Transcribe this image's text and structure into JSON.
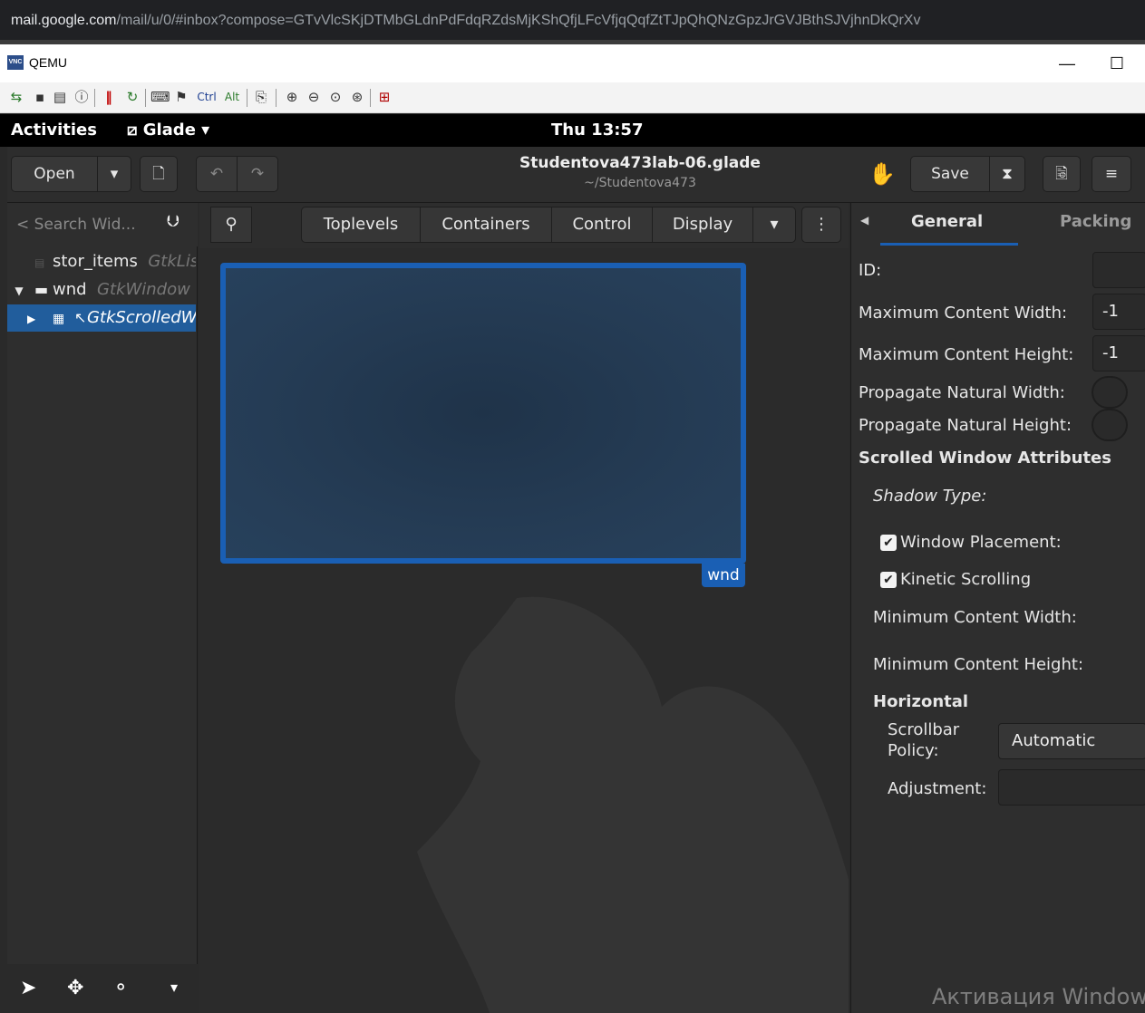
{
  "browser": {
    "url_host": "mail.google.com",
    "url_path": "/mail/u/0/#inbox?compose=GTvVlcSKjDTMbGLdnPdFdqRZdsMjKShQfjLFcVfjqQqfZtTJpQhQNzGpzJrGVJBthSJVjhnDkQrXv"
  },
  "qemu": {
    "title": "QEMU",
    "minimize": "—",
    "maximize": "☐",
    "toolbar_labels": {
      "ctrl": "Ctrl",
      "alt": "Alt"
    }
  },
  "gnome": {
    "activities": "Activities",
    "app_menu": "Glade ▾",
    "clock": "Thu 13:57"
  },
  "header": {
    "open_label": "Open",
    "title": "Studentova473lab-06.glade",
    "subtitle": "~/Studentova473",
    "save_label": "Save"
  },
  "left": {
    "search_placeholder": "< Search Wid...",
    "tree": [
      {
        "name": "stor_items",
        "class": "GtkListStore"
      },
      {
        "name": "wnd",
        "class": "GtkWindow"
      },
      {
        "name": "",
        "class": "GtkScrolledWindow"
      }
    ]
  },
  "palette": {
    "tabs": [
      "Toplevels",
      "Containers",
      "Control",
      "Display"
    ]
  },
  "canvas": {
    "window_tag": "wnd"
  },
  "props": {
    "tabs": [
      "General",
      "Packing"
    ],
    "id_label": "ID:",
    "max_width_label": "Maximum Content Width:",
    "max_width_value": "-1",
    "max_height_label": "Maximum Content Height:",
    "max_height_value": "-1",
    "prop_nat_width_label": "Propagate Natural Width:",
    "prop_nat_height_label": "Propagate Natural Height:",
    "section_title": "Scrolled Window Attributes",
    "shadow_type_label": "Shadow Type:",
    "window_placement_label": "Window Placement:",
    "kinetic_label": "Kinetic Scrolling",
    "min_width_label": "Minimum Content Width:",
    "min_height_label": "Minimum Content Height:",
    "horizontal_title": "Horizontal",
    "scrollbar_label_1": "Scrollbar",
    "scrollbar_label_2": "Policy:",
    "scrollbar_value": "Automatic",
    "adjustment_label": "Adjustment:"
  },
  "watermark": "Активация Windows",
  "colors": {
    "accent": "#1a5fb4",
    "selection": "#215d9c"
  }
}
